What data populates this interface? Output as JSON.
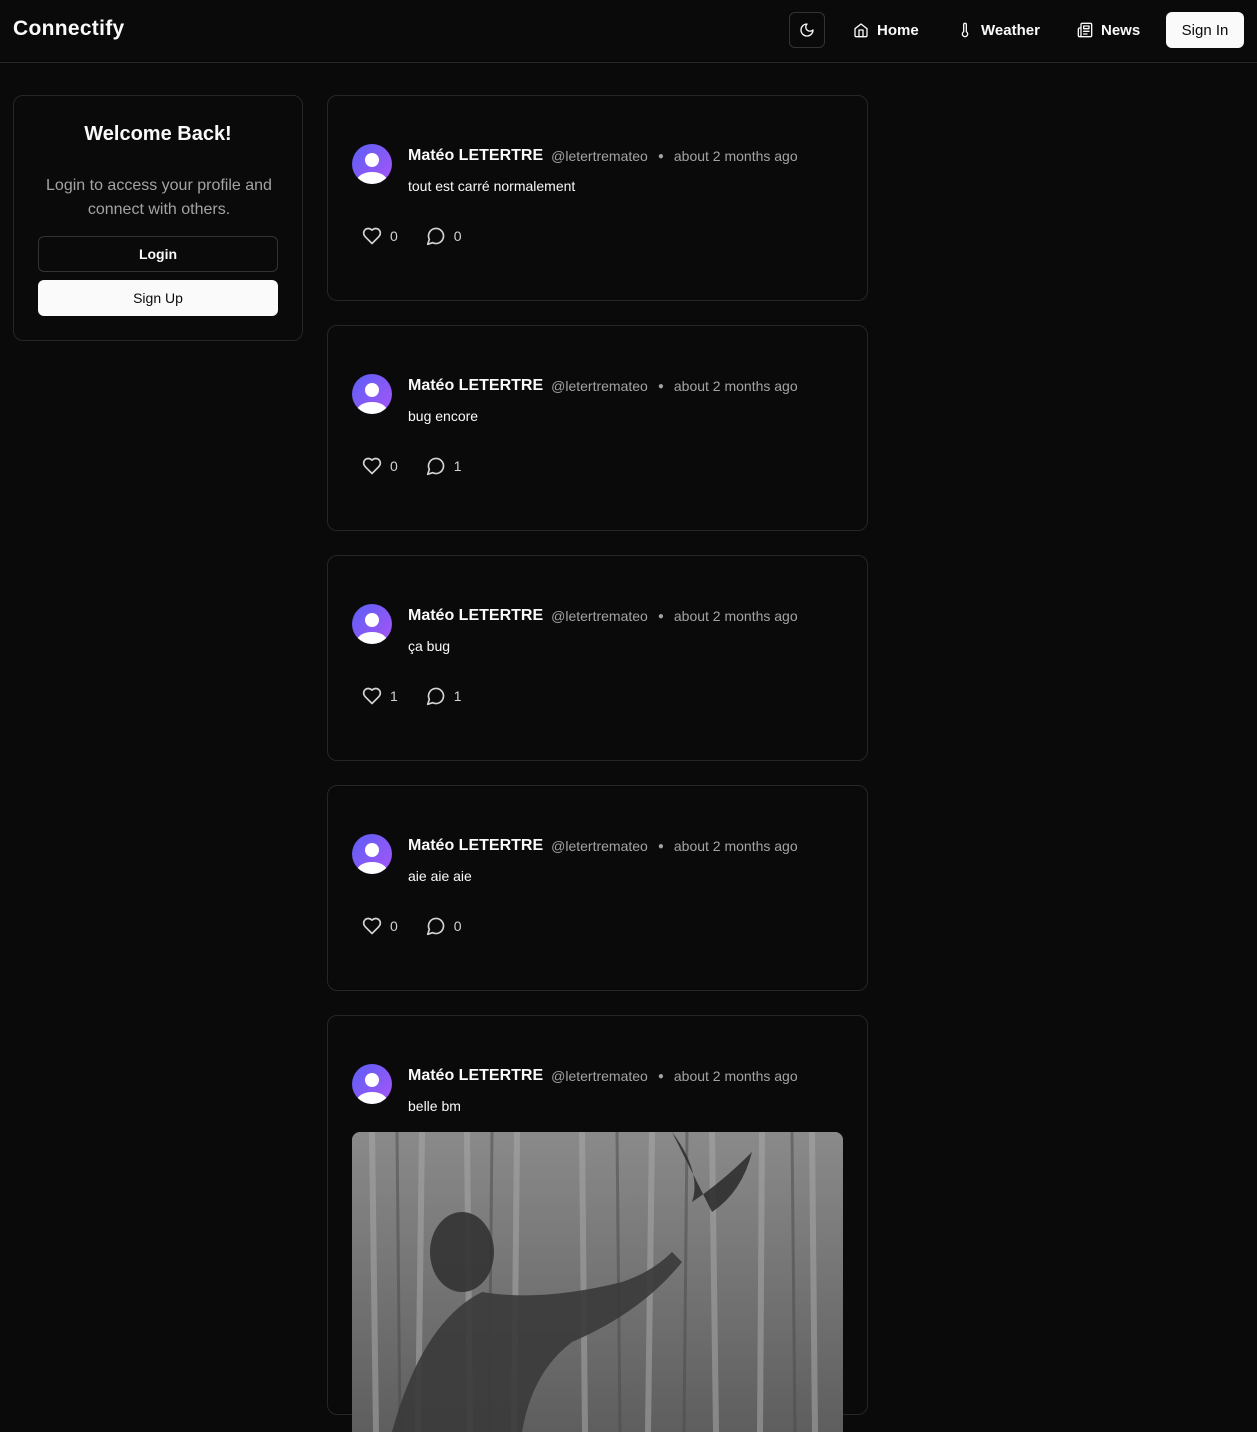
{
  "header": {
    "brand": "Connectify",
    "nav": [
      {
        "label": "Home",
        "icon": "home-icon"
      },
      {
        "label": "Weather",
        "icon": "thermometer-icon"
      },
      {
        "label": "News",
        "icon": "newspaper-icon"
      }
    ],
    "theme_icon": "moon-icon",
    "signin_label": "Sign In"
  },
  "sidebar": {
    "title": "Welcome Back!",
    "text": "Login to access your profile and connect with others.",
    "login_label": "Login",
    "signup_label": "Sign Up"
  },
  "posts": [
    {
      "author": "Matéo LETERTRE",
      "handle": "@letertremateo",
      "time": "about 2 months ago",
      "content": "tout est carré normalement",
      "likes": "0",
      "comments": "0"
    },
    {
      "author": "Matéo LETERTRE",
      "handle": "@letertremateo",
      "time": "about 2 months ago",
      "content": "bug encore",
      "likes": "0",
      "comments": "1"
    },
    {
      "author": "Matéo LETERTRE",
      "handle": "@letertremateo",
      "time": "about 2 months ago",
      "content": "ça bug",
      "likes": "1",
      "comments": "1"
    },
    {
      "author": "Matéo LETERTRE",
      "handle": "@letertremateo",
      "time": "about 2 months ago",
      "content": "aie aie aie",
      "likes": "0",
      "comments": "0"
    },
    {
      "author": "Matéo LETERTRE",
      "handle": "@letertremateo",
      "time": "about 2 months ago",
      "content": "belle bm",
      "has_image": true
    }
  ],
  "colors": {
    "background": "#0a0a0a",
    "border": "#262626",
    "text": "#fafafa",
    "muted": "#a3a3a3",
    "avatar_gradient_start": "#5b5ff5",
    "avatar_gradient_end": "#a855f7"
  }
}
